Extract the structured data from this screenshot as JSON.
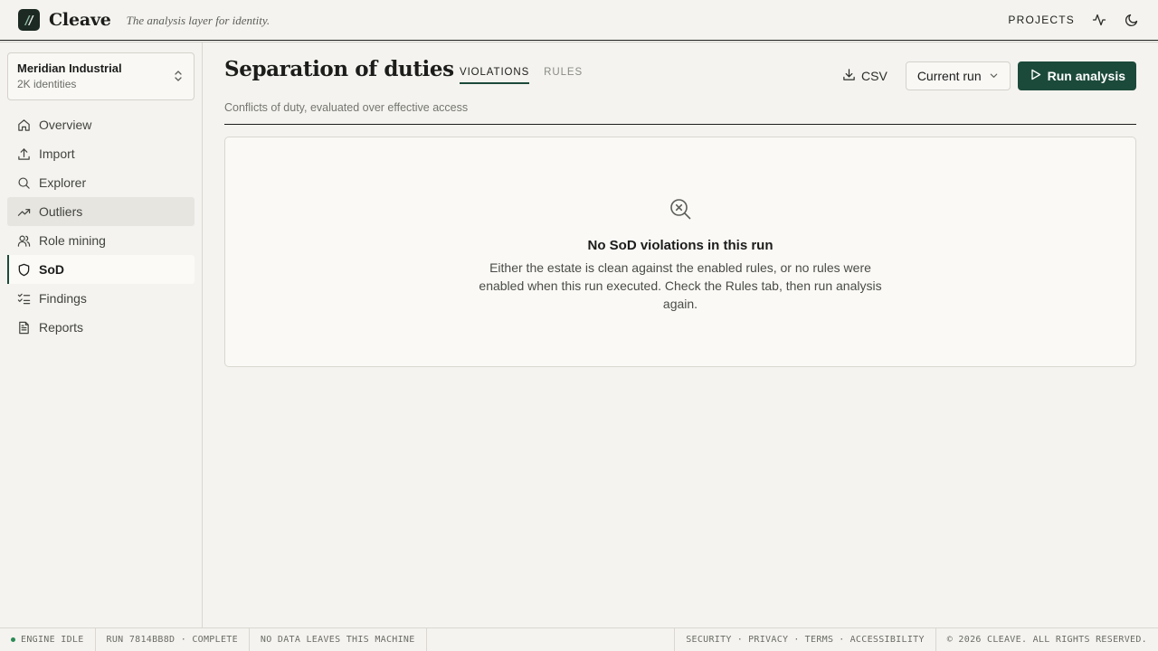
{
  "app": {
    "brand": "Cleave",
    "tagline": "The analysis layer for identity.",
    "projects_label": "PROJECTS",
    "accent_color": "#1c4a3a"
  },
  "header_icons": [
    "activity-icon",
    "moon-icon"
  ],
  "workspace": {
    "name": "Meridian Industrial",
    "subtitle": "2K identities"
  },
  "sidebar": {
    "items": [
      {
        "label": "Overview",
        "icon": "home-icon"
      },
      {
        "label": "Import",
        "icon": "upload-icon"
      },
      {
        "label": "Explorer",
        "icon": "search-icon"
      },
      {
        "label": "Outliers",
        "icon": "trending-up-icon"
      },
      {
        "label": "Role mining",
        "icon": "users-icon"
      },
      {
        "label": "SoD",
        "icon": "shield-icon"
      },
      {
        "label": "Findings",
        "icon": "list-checks-icon"
      },
      {
        "label": "Reports",
        "icon": "file-text-icon"
      }
    ],
    "active": "SoD",
    "hovered": "Outliers"
  },
  "page": {
    "title": "Separation of duties",
    "subtitle": "Conflicts of duty, evaluated over effective access",
    "tabs": [
      {
        "label": "VIOLATIONS",
        "active": true
      },
      {
        "label": "RULES",
        "active": false
      }
    ],
    "csv_label": "CSV",
    "run_select": "Current run",
    "run_button": "Run analysis"
  },
  "empty_state": {
    "title": "No SoD violations in this run",
    "body": "Either the estate is clean against the enabled rules, or no rules were enabled when this run executed. Check the Rules tab, then run analysis again."
  },
  "footer": {
    "engine": "ENGINE IDLE",
    "run": "RUN 7814BB8D · COMPLETE",
    "privacy_note": "NO DATA LEAVES THIS MACHINE",
    "links": [
      "SECURITY",
      "PRIVACY",
      "TERMS",
      "ACCESSIBILITY"
    ],
    "copyright": "© 2026 CLEAVE. ALL RIGHTS RESERVED."
  }
}
